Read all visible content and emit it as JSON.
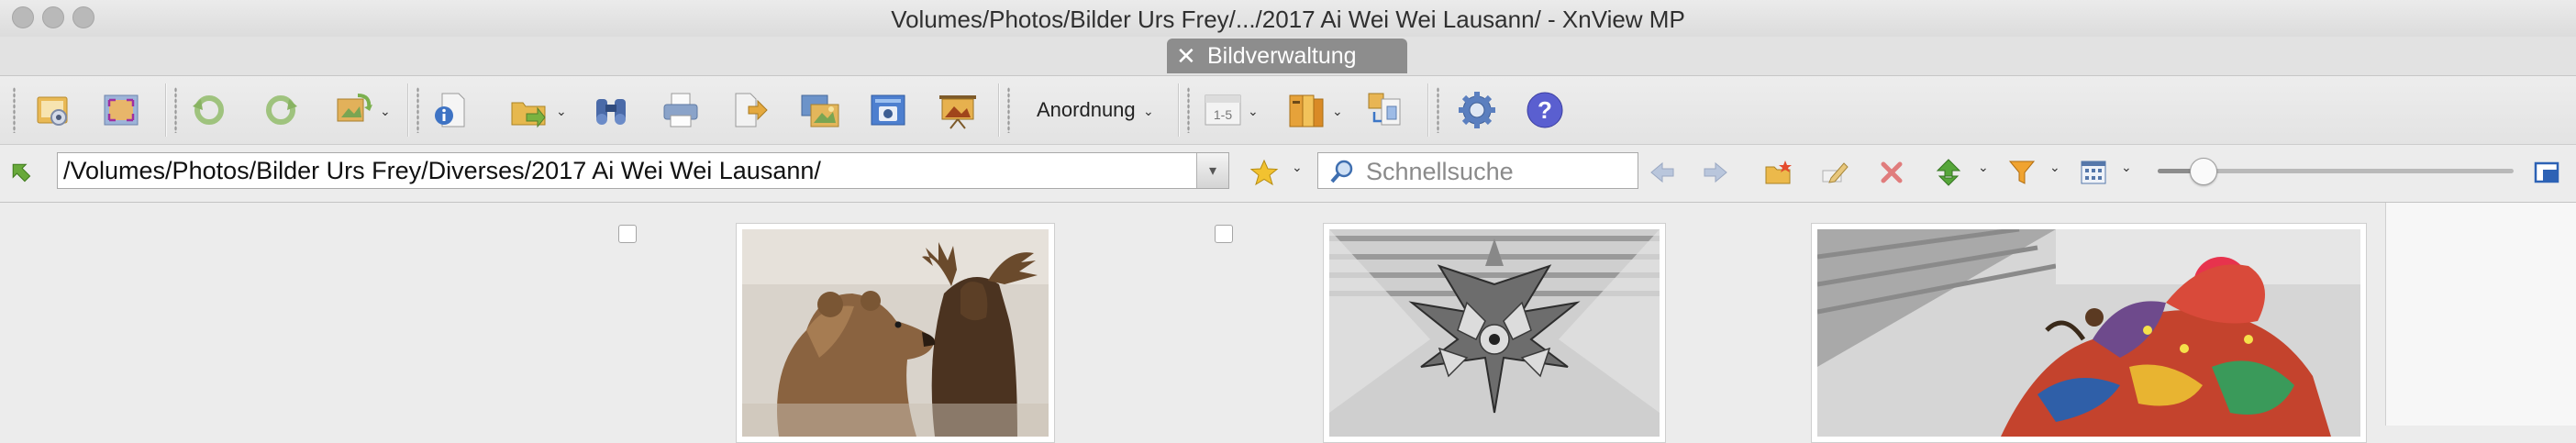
{
  "window": {
    "title": "Volumes/Photos/Bilder Urs Frey/.../2017 Ai Wei Wei Lausann/ - XnView MP",
    "tab_label": "Bildverwaltung",
    "tab_close_glyph": "✕"
  },
  "toolbar": {
    "arrange_label": "Anordnung",
    "buttons": [
      "open-folder-icon",
      "fullscreen-icon",
      "rotate-left-icon",
      "rotate-right-icon",
      "edit-image-icon",
      "properties-icon",
      "export-icon",
      "binoculars-icon",
      "print-icon",
      "move-icon",
      "batch-convert-icon",
      "capture-icon",
      "slideshow-icon",
      "page-range-icon",
      "book-icon",
      "compare-icon",
      "settings-icon",
      "help-icon"
    ],
    "page_range_label": "1-5"
  },
  "addressbar": {
    "path": "/Volumes/Photos/Bilder Urs Frey/Diverses/2017 Ai Wei Wei Lausann/",
    "search_placeholder": "Schnellsuche",
    "zoom_level": 0.13
  },
  "thumbnails": [
    {
      "subject": "bear-and-moose-photo",
      "checked": false
    },
    {
      "subject": "paper-kite-sculpture-photo",
      "checked": false
    },
    {
      "subject": "colorful-dragon-kite-photo",
      "checked": false
    }
  ],
  "colors": {
    "accent_blue": "#3b78c4",
    "help_purple": "#5a5fd0",
    "tab_gray": "#8d8d8d"
  }
}
